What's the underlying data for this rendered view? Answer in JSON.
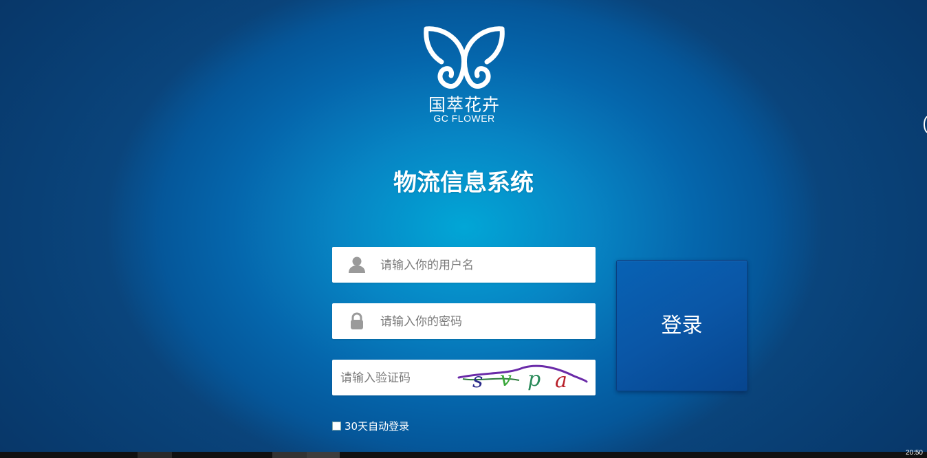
{
  "logo": {
    "cn_text": "国萃花卉",
    "en_text": "GC FLOWER",
    "icon": "butterfly-logo"
  },
  "title": "物流信息系统",
  "form": {
    "username": {
      "placeholder": "请输入你的用户名",
      "value": "",
      "icon": "user-icon"
    },
    "password": {
      "placeholder": "请输入你的密码",
      "value": "",
      "icon": "lock-icon"
    },
    "captcha": {
      "placeholder": "请输入验证码",
      "value": "",
      "image_text": "svpa"
    },
    "remember_label": "30天自动登录",
    "remember_checked": false,
    "login_label": "登录"
  },
  "taskbar": {
    "clock": "20:50"
  },
  "colors": {
    "background_center": "#02a6d6",
    "background_edge": "#0a467e",
    "button": "#0a56a6"
  }
}
